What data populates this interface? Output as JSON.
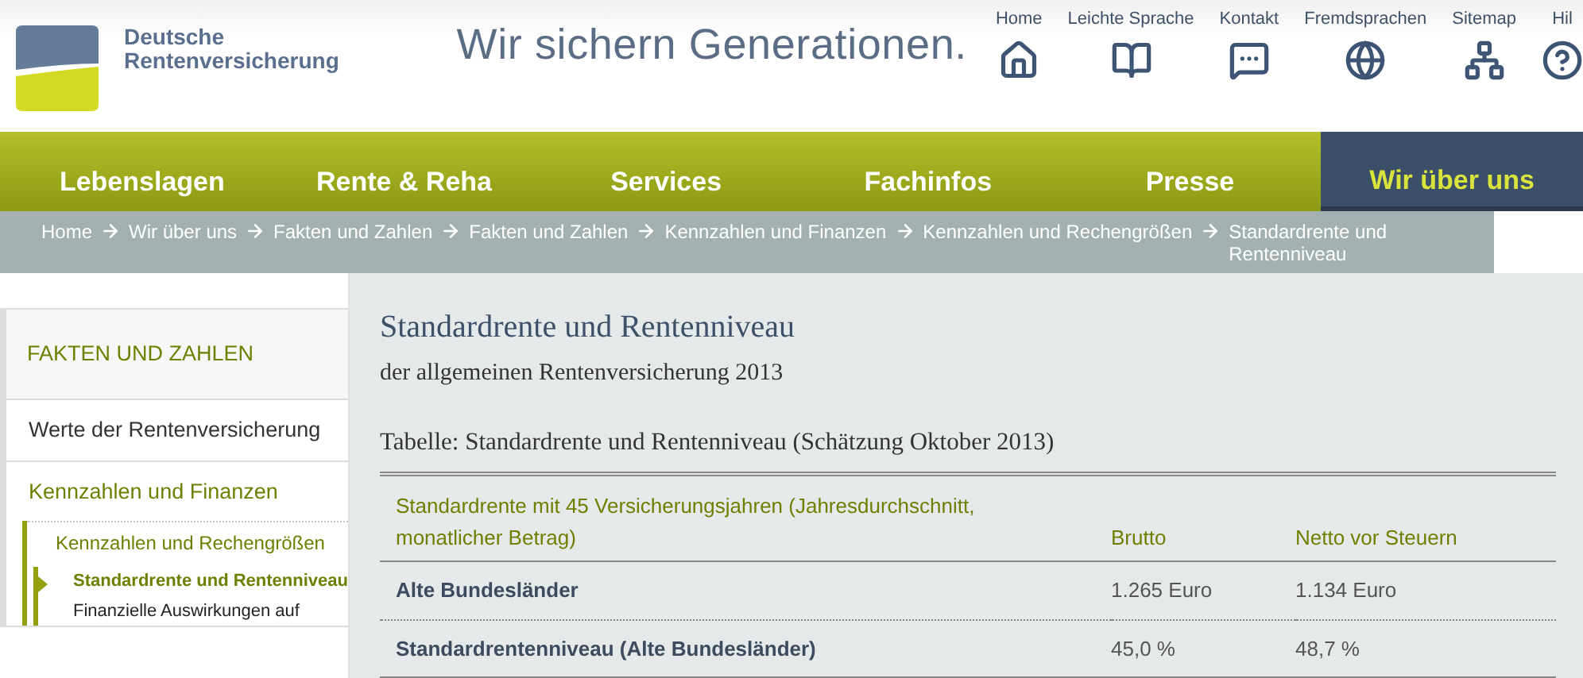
{
  "brand": {
    "name_line_1": "Deutsche",
    "name_line_2": "Rentenversicherung",
    "slogan": "Wir sichern Generationen."
  },
  "service_links": [
    "Home",
    "Leichte Sprache",
    "Kontakt",
    "Fremdsprachen",
    "Sitemap",
    "Hil"
  ],
  "nav_tabs": [
    {
      "label": "Lebenslagen",
      "selected": false
    },
    {
      "label": "Rente & Reha",
      "selected": false
    },
    {
      "label": "Services",
      "selected": false
    },
    {
      "label": "Fachinfos",
      "selected": false
    },
    {
      "label": "Presse",
      "selected": false
    },
    {
      "label": "Wir über uns",
      "selected": true
    }
  ],
  "breadcrumb": [
    "Home",
    "Wir über uns",
    "Fakten und Zahlen",
    "Fakten und Zahlen",
    "Kennzahlen und Finanzen",
    "Kennzahlen und Rechengrößen",
    "Standardrente und Rentenniveau"
  ],
  "sidebar": {
    "heading": "FAKTEN UND ZAHLEN",
    "items": [
      {
        "label": "Werte der Rentenversicherung",
        "selected": false
      },
      {
        "label": "Kennzahlen und Finanzen",
        "selected": false,
        "children": [
          {
            "label": "Kennzahlen und Rechengrößen",
            "selected": false,
            "children": [
              {
                "label": "Standardrente und Rentenniveau",
                "selected": true
              },
              {
                "label": "Finanzielle Auswirkungen auf",
                "selected": false
              }
            ]
          }
        ]
      }
    ]
  },
  "content": {
    "title": "Standardrente und Rentenniveau",
    "subtitle": "der allgemeinen Rentenversicherung 2013",
    "table": {
      "caption": "Tabelle: Standardrente und Rentenniveau (Schätzung Oktober 2013)",
      "columns": [
        "Standardrente mit 45 Versicherungsjahren (Jahresdurchschnitt, monatlicher Betrag)",
        "Brutto",
        "Netto vor Steuern"
      ],
      "rows": [
        [
          "Alte Bundesländer",
          "1.265 Euro",
          "1.134 Euro"
        ],
        [
          "Standardrentenniveau (Alte Bundesländer)",
          "45,0 %",
          "48,7 %"
        ]
      ]
    }
  }
}
